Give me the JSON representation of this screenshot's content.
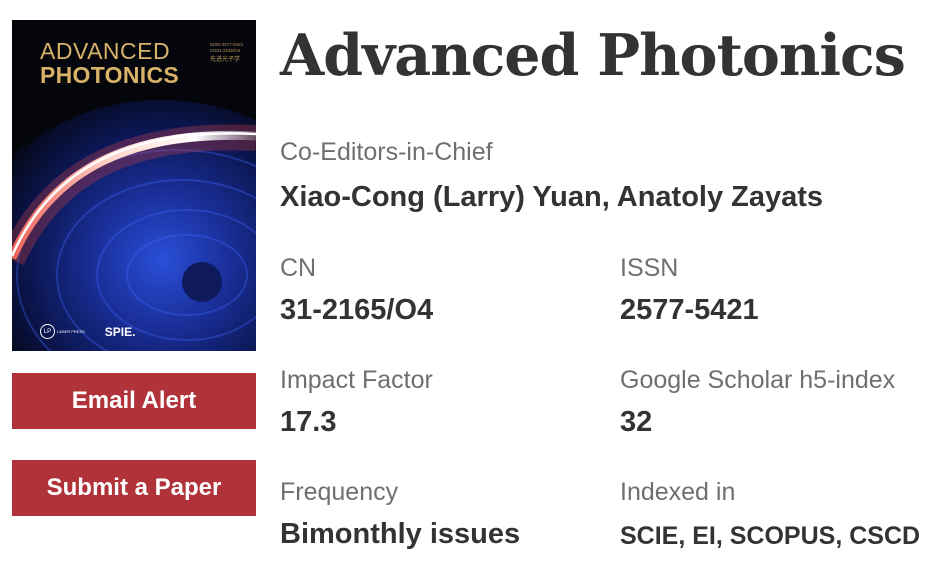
{
  "cover": {
    "title_line1": "ADVANCED",
    "title_line2": "PHOTONICS",
    "issn_line1": "ISSN 2577-5421",
    "issn_line2": "CN31-2165/O4",
    "cn_text": "先进光子学",
    "publisher1_mark": "LP",
    "publisher1_text": "LASER PRESS",
    "publisher2": "SPIE."
  },
  "buttons": {
    "email_alert": "Email Alert",
    "submit_paper": "Submit a Paper"
  },
  "journal": {
    "title": "Advanced Photonics"
  },
  "editors": {
    "label": "Co-Editors-in-Chief",
    "value": "Xiao-Cong (Larry) Yuan, Anatoly Zayats"
  },
  "fields": {
    "cn": {
      "label": "CN",
      "value": "31-2165/O4"
    },
    "issn": {
      "label": "ISSN",
      "value": "2577-5421"
    },
    "impact_factor": {
      "label": "Impact Factor",
      "value": "17.3"
    },
    "h5_index": {
      "label": "Google Scholar h5-index",
      "value": "32"
    },
    "frequency": {
      "label": "Frequency",
      "value": "Bimonthly issues"
    },
    "indexed_in": {
      "label": "Indexed in",
      "value": "SCIE, EI, SCOPUS, CSCD"
    }
  },
  "colors": {
    "button_bg": "#b0333a",
    "title_text": "#333333",
    "label_text": "#6f6f6f",
    "cover_gold": "#d9b26a"
  }
}
